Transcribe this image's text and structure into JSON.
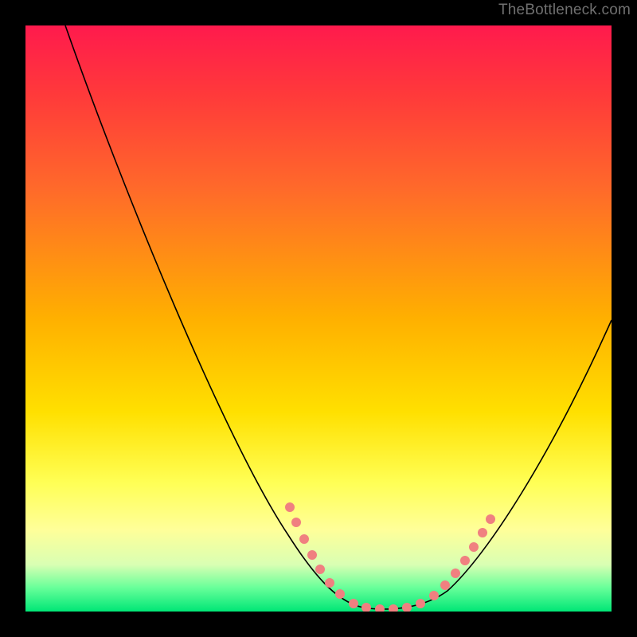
{
  "watermark": {
    "text": "TheBottleneck.com"
  },
  "colors": {
    "gradient_top": "#ff1a4d",
    "gradient_mid": "#ffe000",
    "gradient_bottom": "#00e676",
    "curve": "#000000",
    "dots": "#f08080",
    "frame": "#000000"
  },
  "chart_data": {
    "type": "line",
    "title": "",
    "xlabel": "",
    "ylabel": "",
    "xlim": [
      0,
      100
    ],
    "ylim": [
      0,
      100
    ],
    "grid": false,
    "x": [
      0,
      5,
      10,
      15,
      20,
      25,
      30,
      35,
      40,
      45,
      50,
      55,
      58,
      60,
      62,
      65,
      70,
      75,
      80,
      85,
      90,
      95,
      100
    ],
    "y": [
      100,
      92,
      83,
      73,
      63,
      53,
      42,
      31,
      20,
      11,
      4,
      0.6,
      0.2,
      0.1,
      0.1,
      0.2,
      0.6,
      4,
      12,
      22,
      33,
      44,
      55
    ],
    "dot_regions": [
      {
        "x_range": [
          45,
          55
        ],
        "y_range": [
          0.1,
          12
        ],
        "side": "left"
      },
      {
        "x_range": [
          55,
          70
        ],
        "y_range": [
          0.1,
          0.6
        ],
        "side": "bottom"
      },
      {
        "x_range": [
          70,
          80
        ],
        "y_range": [
          0.6,
          12
        ],
        "side": "right"
      }
    ]
  }
}
